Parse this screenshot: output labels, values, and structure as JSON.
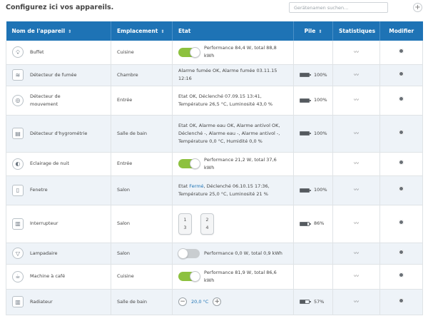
{
  "header": {
    "title": "Configurez ici vos appareils.",
    "search_placeholder": "Gerätenamen suchen...",
    "add_label": "+"
  },
  "columns": {
    "name": "Nom de l'appareil",
    "location": "Emplacement",
    "state": "Etat",
    "battery": "Pile",
    "stats": "Statistiques",
    "edit": "Modifier",
    "sort_icon": "sort-icon"
  },
  "colors": {
    "header_blue": "#1e73b5",
    "toggle_on": "#8dc13f",
    "row_alt": "#eef3f8"
  },
  "rows": [
    {
      "icon": "bulb-icon",
      "name": "Buffet",
      "location": "Cuisine",
      "toggle": "on",
      "state": "Performance 84,4 W, total 88,8 kWh"
    },
    {
      "icon": "smoke-icon",
      "name": "Détecteur de fumée",
      "location": "Chambre",
      "state": "Alarme fumée OK, Alarme fumée 03.11.15 12:16",
      "battery_level": 100,
      "battery_label": "100%"
    },
    {
      "icon": "motion-icon",
      "name": "Détecteur de mouvement",
      "location": "Entrée",
      "state_lines": [
        "Etat OK, Déclenché 07.09.15 13:41,",
        "Température 26,5 °C, Luminosité 43,0 %"
      ],
      "battery_level": 100,
      "battery_label": "100%"
    },
    {
      "icon": "hygrometer-icon",
      "name": "Détecteur d'hygrométrie",
      "location": "Salle de bain",
      "state_lines": [
        "Etat OK, Alarme eau OK, Alarme antivol OK,",
        "Déclenché -, Alarme eau -, Alarme antivol -,",
        "Température 0,0 °C, Humidité 0,0 %"
      ],
      "battery_level": 100,
      "battery_label": "100%"
    },
    {
      "icon": "night-light-icon",
      "name": "Eclairage de nuit",
      "location": "Entrée",
      "toggle": "on",
      "state": "Performance 21,2 W, total 37,6 kWh"
    },
    {
      "icon": "window-icon",
      "name": "Fenetre",
      "location": "Salon",
      "state_prefix": "Etat",
      "state_status": "Fermé",
      "state_rest": ", Déclenché 06.10.15 17:36,",
      "state_line2": "Température 25,0 °C, Luminosité 21 %",
      "battery_level": 100,
      "battery_label": "100%"
    },
    {
      "icon": "switch-icon",
      "name": "Interrupteur",
      "location": "Salon",
      "buttons": [
        "1",
        "2",
        "3",
        "4"
      ],
      "battery_level": 86,
      "battery_label": "86%"
    },
    {
      "icon": "lamp-icon",
      "name": "Lampadaire",
      "location": "Salon",
      "toggle": "off",
      "state": "Performance 0,0 W, total 0,9 kWh"
    },
    {
      "icon": "coffee-icon",
      "name": "Machine à café",
      "location": "Cuisine",
      "toggle": "on",
      "state": "Performance 81,9 W, total 86,6 kWh"
    },
    {
      "icon": "radiator-icon",
      "name": "Radiateur",
      "location": "Salle de bain",
      "temp": "20,0 °C",
      "minus": "−",
      "plus": "+",
      "battery_level": 57,
      "battery_label": "57%"
    }
  ]
}
